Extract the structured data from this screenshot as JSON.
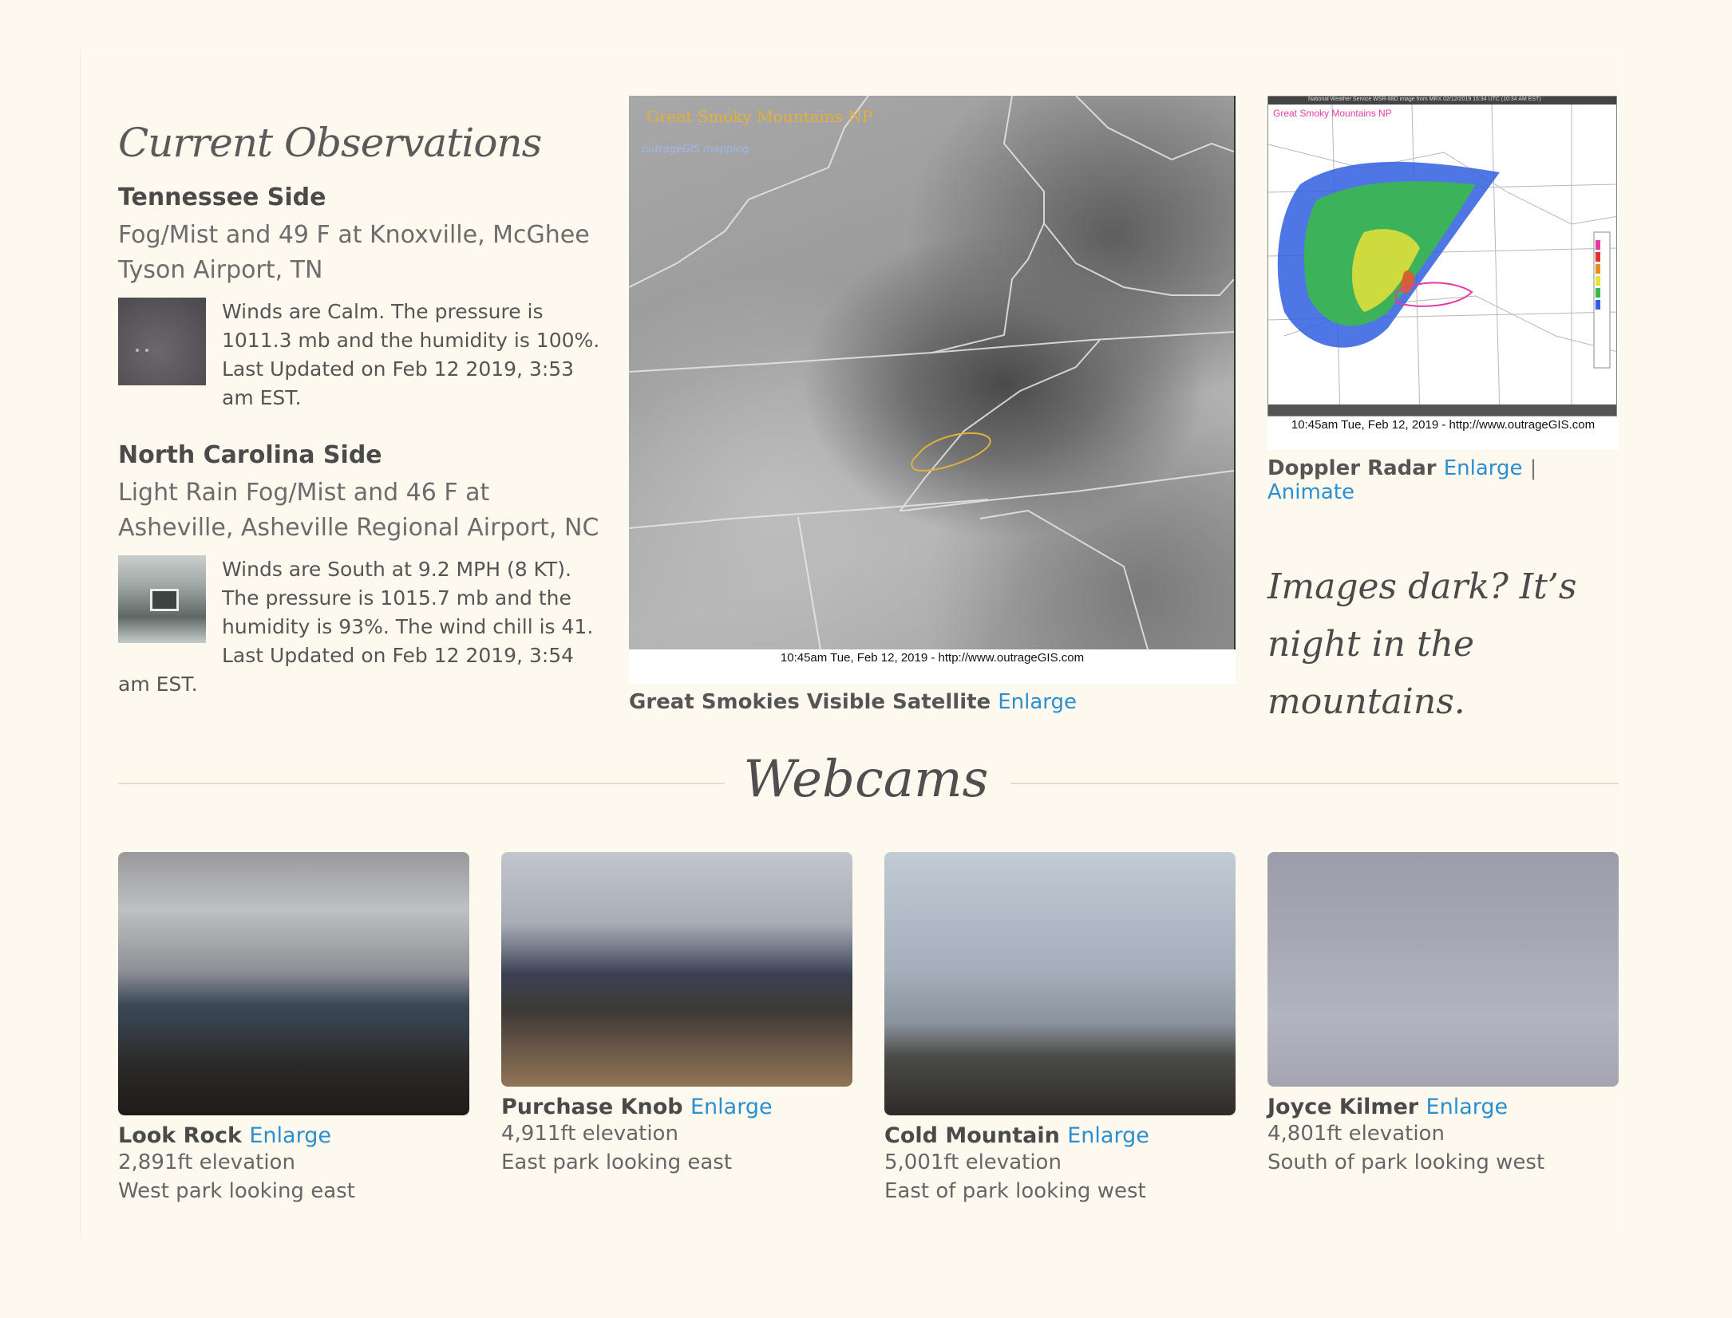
{
  "observations": {
    "title": "Current Observations",
    "tennessee": {
      "heading": "Tennessee Side",
      "condition": "Fog/Mist and 49 F at Knoxville, McGhee Tyson Airport, TN",
      "detail": "Winds are Calm. The pressure is 1011.3 mb and the humidity is 100%. Last Updated on Feb 12 2019, 3:53 am EST."
    },
    "north_carolina": {
      "heading": "North Carolina Side",
      "condition": "Light Rain Fog/Mist and 46 F at Asheville, Asheville Regional Airport, NC",
      "detail": "Winds are South at 9.2 MPH (8 KT). The pressure is 1015.7 mb and the humidity is 93%. The wind chill is 41. Last Updated on Feb 12 2019, 3:54 am EST."
    }
  },
  "satellite": {
    "overlay_title": "Great Smoky Mountains NP",
    "overlay_sub": "outrageGIS mapping",
    "timestamp": "10:45am Tue, Feb 12, 2019 - http://www.outrageGIS.com",
    "caption": "Great Smokies Visible Satellite",
    "enlarge": "Enlarge"
  },
  "radar": {
    "overlay_title": "Great Smoky Mountains NP",
    "header_text": "National Weather Service WSR-88D image from MRX 02/12/2019 15:34 UTC (10:34 AM EST)",
    "timestamp": "10:45am Tue, Feb 12, 2019 - http://www.outrageGIS.com",
    "caption": "Doppler Radar",
    "enlarge": "Enlarge",
    "separator": "|",
    "animate": "Animate"
  },
  "night_note": "Images dark? It’s night in the mountains.",
  "webcams": {
    "title": "Webcams",
    "items": [
      {
        "name": "Look Rock",
        "enlarge": "Enlarge",
        "elevation": "2,891ft elevation",
        "view": "West park looking east"
      },
      {
        "name": "Purchase Knob",
        "enlarge": "Enlarge",
        "elevation": "4,911ft elevation",
        "view": "East park looking east"
      },
      {
        "name": "Cold Mountain",
        "enlarge": "Enlarge",
        "elevation": "5,001ft elevation",
        "view": "East of park looking west"
      },
      {
        "name": "Joyce Kilmer",
        "enlarge": "Enlarge",
        "elevation": "4,801ft elevation",
        "view": "South of park looking west"
      }
    ]
  },
  "colors": {
    "background": "#fcf8ee",
    "link": "#2a8fd0",
    "text": "#4d4d4d"
  }
}
